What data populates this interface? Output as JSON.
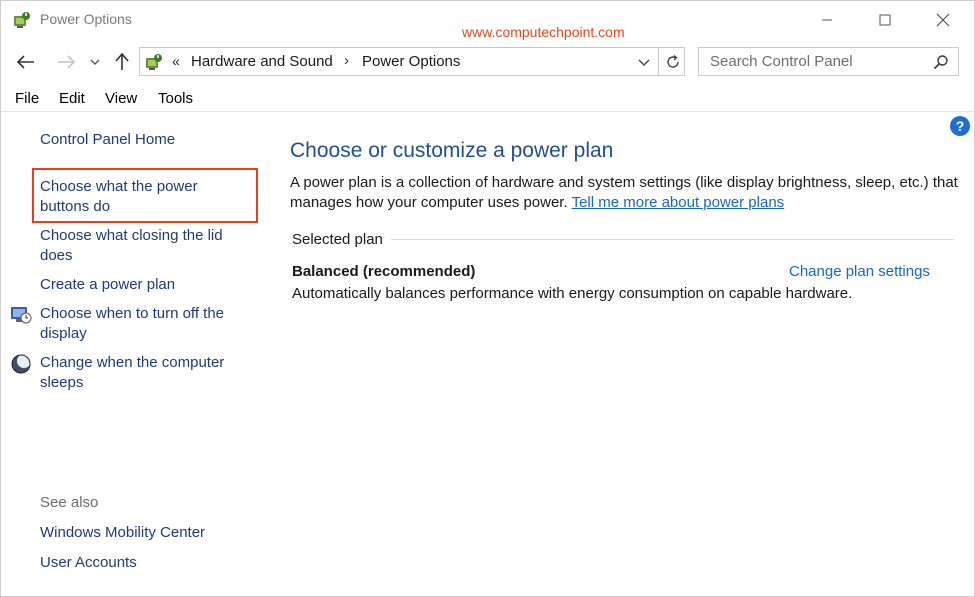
{
  "window": {
    "title": "Power Options",
    "watermark": "www.computechpoint.com"
  },
  "navigation": {
    "breadcrumb_overflow": "«",
    "breadcrumb": [
      "Hardware and Sound",
      "Power Options"
    ],
    "breadcrumb_separator": "›",
    "search_placeholder": "Search Control Panel"
  },
  "menu": [
    "File",
    "Edit",
    "View",
    "Tools"
  ],
  "sidebar": {
    "home": "Control Panel Home",
    "items": [
      "Choose what the power buttons do",
      "Choose what closing the lid does",
      "Create a power plan",
      "Choose when to turn off the display",
      "Change when the computer sleeps"
    ],
    "see_also_label": "See also",
    "see_also": [
      "Windows Mobility Center",
      "User Accounts"
    ]
  },
  "main": {
    "title": "Choose or customize a power plan",
    "description": "A power plan is a collection of hardware and system settings (like display brightness, sleep, etc.) that manages how your computer uses power.",
    "description_link": "Tell me more about power plans",
    "selected_plan_label": "Selected plan",
    "plan": {
      "name": "Balanced (recommended)",
      "change_link": "Change plan settings",
      "description": "Automatically balances performance with energy consumption on capable hardware."
    }
  },
  "colors": {
    "link_dark": "#1e3a78",
    "link_blue": "#1767c8",
    "heading_blue": "#1f4e9a",
    "highlight_red": "#e8401c"
  },
  "icons": [
    "power-options-icon",
    "minimize-icon",
    "maximize-icon",
    "close-icon",
    "back-arrow-icon",
    "forward-arrow-icon",
    "chevron-down-icon",
    "up-arrow-icon",
    "refresh-icon",
    "search-icon",
    "display-timer-icon",
    "moon-sleep-icon",
    "help-icon"
  ]
}
